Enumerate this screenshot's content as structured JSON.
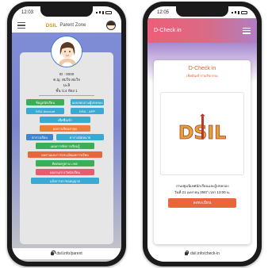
{
  "left_phone": {
    "status": {
      "time": "12:03"
    },
    "header": {
      "brand": "DSIL",
      "title": "Parent Zone"
    },
    "profile": {
      "id": "ID : 0000",
      "name": "ด.ญ. สมใจ สมใจ",
      "nickname": "มะลิ",
      "class": "ชั้น ป.4 ห้อง 1"
    },
    "menu": [
      {
        "label": "ข้อมูลนักเรียน",
        "color": "#3cae57"
      },
      {
        "label": "แบบสอบถามผู้ปกครอง",
        "color": "#3aa9d3"
      },
      {
        "label": "DSIL Account",
        "color": "#3aa9d3"
      },
      {
        "label": "DSIL - APP",
        "color": "#3aa9d3"
      },
      {
        "label": "เช็คชื่อเข้า",
        "color": "#3aa9d3"
      },
      {
        "label": "ผลการเรียนล่าสุด",
        "color": "#ee7d3b"
      },
      {
        "label": "ตารางเรียน",
        "color": "#3b86cf"
      },
      {
        "label": "ตารางนัดหมาย",
        "color": "#3aa9d3"
      },
      {
        "label": "แผนการจัดการเรียนรู้",
        "color": "#3cae57"
      },
      {
        "label": "ผลงานและการประเมินผลการเรียน",
        "color": "#e8663a"
      },
      {
        "label": "ติดต่อครูผ่าน LINE",
        "color": "#3cae57"
      },
      {
        "label": "ผลงาน/รางวัลนักเรียน",
        "color": "#e85c6f"
      },
      {
        "label": "แจ้งการลา/ขออนุญาต",
        "color": "#3aa9d3"
      }
    ],
    "url": "dsil.info/parent"
  },
  "right_phone": {
    "status": {
      "time": "12:05"
    },
    "header": {
      "title": "D-Check in"
    },
    "card": {
      "title": "D-Check in",
      "subtitle": "เช็คอินเข้าร่วมกิจกรรม",
      "logo": "DSIL",
      "event_line1": "งานปฐมนิเทศนักเรียนและผู้ปกครอง",
      "event_line2": "วันที่ 21 เมษายน 2567 เวลา 13:00 น.",
      "button": "ลงทะเบียน"
    },
    "url": "dsil.info/check-in"
  }
}
